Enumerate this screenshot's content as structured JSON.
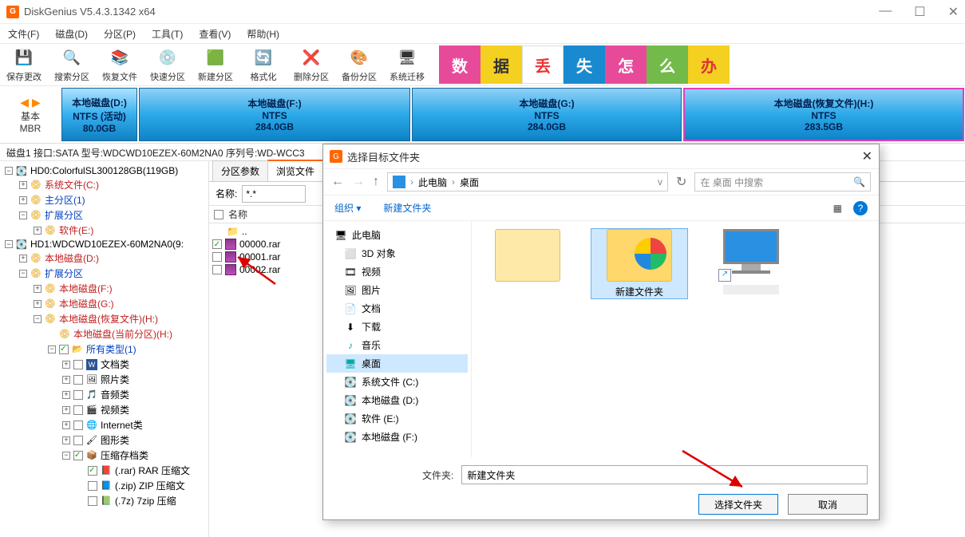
{
  "window": {
    "title": "DiskGenius V5.4.3.1342 x64"
  },
  "window_buttons": {
    "min": "—",
    "max": "☐",
    "close": "✕"
  },
  "menu": {
    "file": "文件(F)",
    "disk": "磁盘(D)",
    "part": "分区(P)",
    "tools": "工具(T)",
    "view": "查看(V)",
    "help": "帮助(H)"
  },
  "toolbar": {
    "save": "保存更改",
    "search": "搜索分区",
    "recover": "恢复文件",
    "fast": "快速分区",
    "new": "新建分区",
    "format": "格式化",
    "delete": "删除分区",
    "backup": "备份分区",
    "migrate": "系统迁移"
  },
  "banner": {
    "t0": "数",
    "t1": "据",
    "t2": "丢",
    "t3": "失",
    "t4": "怎",
    "t5": "么",
    "t6": "办"
  },
  "diskbar": {
    "basic_arrows": "◀ ▶",
    "basic1": "基本",
    "basic2": "MBR",
    "p0": {
      "n": "本地磁盘(D:)",
      "fs": "NTFS (活动)",
      "sz": "80.0GB"
    },
    "p1": {
      "n": "本地磁盘(F:)",
      "fs": "NTFS",
      "sz": "284.0GB"
    },
    "p2": {
      "n": "本地磁盘(G:)",
      "fs": "NTFS",
      "sz": "284.0GB"
    },
    "p3": {
      "n": "本地磁盘(恢复文件)(H:)",
      "fs": "NTFS",
      "sz": "283.5GB"
    }
  },
  "statusline": "磁盘1  接口:SATA  型号:WDCWD10EZEX-60M2NA0  序列号:WD-WCC3",
  "tree": {
    "hd0": "HD0:ColorfulSL300128GB(119GB)",
    "hd0_sys": "系统文件(C:)",
    "hd0_pri": "主分区(1)",
    "hd0_ext": "扩展分区",
    "hd0_soft": "软件(E:)",
    "hd1": "HD1:WDCWD10EZEX-60M2NA0(9:",
    "d": "本地磁盘(D:)",
    "ext": "扩展分区",
    "f": "本地磁盘(F:)",
    "g": "本地磁盘(G:)",
    "h": "本地磁盘(恢复文件)(H:)",
    "h_cur": "本地磁盘(当前分区)(H:)",
    "all": "所有类型(1)",
    "doc": "文档类",
    "pic": "照片类",
    "aud": "音频类",
    "vid": "视频类",
    "net": "Internet类",
    "gfx": "图形类",
    "zip": "压缩存档类",
    "rar": "(.rar) RAR 压缩文",
    "zip2": "(.zip) ZIP 压缩文",
    "7z": "(.7z) 7zip 压缩"
  },
  "tabs": {
    "param": "分区参数",
    "browse": "浏览文件"
  },
  "filter": {
    "label": "名称:",
    "value": "*.*"
  },
  "filehdr": "名称",
  "files": {
    "up": "..",
    "f0": "00000.rar",
    "f1": "00001.rar",
    "f2": "00002.rar"
  },
  "dialog": {
    "title": "选择目标文件夹",
    "breadcrumb": {
      "pc": "此电脑",
      "desk": "桌面"
    },
    "search_placeholder": "在 桌面 中搜索",
    "organize": "组织",
    "newfolder": "新建文件夹",
    "side": {
      "pc": "此电脑",
      "d3d": "3D 对象",
      "video": "视频",
      "image": "图片",
      "doc": "文档",
      "dl": "下载",
      "music": "音乐",
      "desk": "桌面",
      "sysc": "系统文件 (C:)",
      "locald": "本地磁盘 (D:)",
      "softe": "软件 (E:)",
      "localf": "本地磁盘 (F:)"
    },
    "items": {
      "folder1_label": "",
      "folder2_label": "新建文件夹",
      "item3_label": ""
    },
    "folder_label": "文件夹:",
    "folder_value": "新建文件夹",
    "ok": "选择文件夹",
    "cancel": "取消",
    "refresh": "↻",
    "view_icon": "▦",
    "help": "?"
  }
}
